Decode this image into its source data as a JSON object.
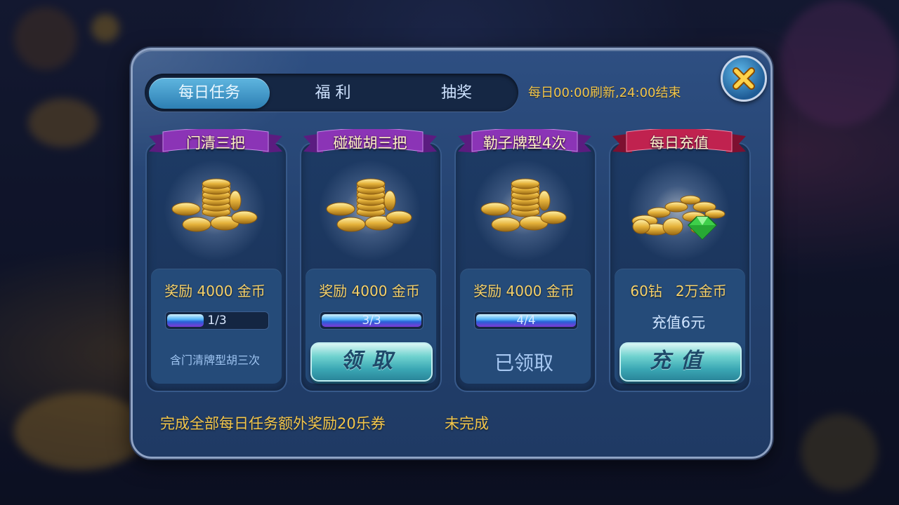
{
  "tabs": [
    {
      "label": "每日任务",
      "active": true
    },
    {
      "label": "福 利",
      "active": false
    },
    {
      "label": "抽奖",
      "active": false
    }
  ],
  "refresh_note": "每日00:00刷新,24:00结束",
  "tasks": [
    {
      "title": "门清三把",
      "reward": "奖励 4000 金币",
      "progress_text": "1/3",
      "progress": 0.33,
      "description": "含门清牌型胡三次"
    },
    {
      "title": "碰碰胡三把",
      "reward": "奖励 4000 金币",
      "progress_text": "3/3",
      "progress": 1.0,
      "button_label": "领取"
    },
    {
      "title": "勒子牌型4次",
      "reward": "奖励 4000 金币",
      "progress_text": "4/4",
      "progress": 1.0,
      "status": "已领取"
    },
    {
      "title": "每日充值",
      "reward": "60钻   2万金币",
      "price": "充值6元",
      "button_label": "充值"
    }
  ],
  "footer": {
    "bonus_text": "完成全部每日任务额外奖励20乐券",
    "status": "未完成"
  },
  "colors": {
    "gold_text": "#f3c64b",
    "panel": "#24426f",
    "ribbon_purple": "#7a2aa0",
    "ribbon_red": "#b81e4a",
    "button_teal": "#3aa7b4"
  }
}
